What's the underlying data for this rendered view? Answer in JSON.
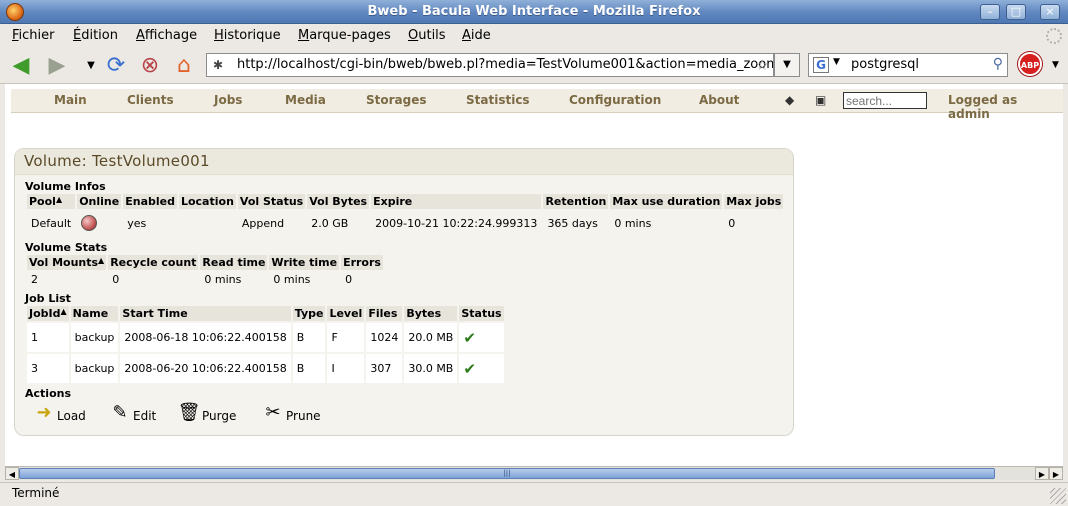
{
  "window": {
    "title": "Bweb - Bacula Web Interface - Mozilla Firefox",
    "min_label": "–",
    "max_label": "□",
    "close_label": "×"
  },
  "menu": [
    "Fichier",
    "Édition",
    "Affichage",
    "Historique",
    "Marque-pages",
    "Outils",
    "Aide"
  ],
  "toolbar": {
    "url": "http://localhost/cgi-bin/bweb/bweb.pl?media=TestVolume001&action=media_zoom",
    "search_value": "postgresql",
    "abp_label": "ABP"
  },
  "site": {
    "nav": [
      "Main",
      "Clients",
      "Jobs",
      "Media",
      "Storages",
      "Statistics",
      "Configuration",
      "About"
    ],
    "search_placeholder": "search...",
    "logged": "Logged as admin"
  },
  "volume": {
    "title": "Volume: TestVolume001",
    "infos_label": "Volume Infos",
    "infos_headers": [
      "Pool",
      "Online",
      "Enabled",
      "Location",
      "Vol Status",
      "Vol Bytes",
      "Expire",
      "Retention",
      "Max use duration",
      "Max jobs"
    ],
    "infos_row": {
      "pool": "Default",
      "enabled": "yes",
      "location": "",
      "vol_status": "Append",
      "vol_bytes": "2.0 GB",
      "expire": "2009-10-21 10:22:24.999313",
      "retention": "365 days",
      "max_use_duration": "0 mins",
      "max_jobs": "0"
    },
    "stats_label": "Volume Stats",
    "stats_headers": [
      "Vol Mounts",
      "Recycle count",
      "Read time",
      "Write time",
      "Errors"
    ],
    "stats_row": [
      "2",
      "0",
      "0 mins",
      "0 mins",
      "0"
    ],
    "joblist_label": "Job List",
    "job_headers": [
      "JobId",
      "Name",
      "Start Time",
      "Type",
      "Level",
      "Files",
      "Bytes",
      "Status"
    ],
    "jobs": [
      {
        "jobid": "1",
        "name": "backup",
        "start": "2008-06-18 10:06:22.400158",
        "type": "B",
        "level": "F",
        "files": "1024",
        "bytes": "20.0 MB"
      },
      {
        "jobid": "3",
        "name": "backup",
        "start": "2008-06-20 10:06:22.400158",
        "type": "B",
        "level": "I",
        "files": "307",
        "bytes": "30.0 MB"
      }
    ],
    "actions_label": "Actions",
    "actions": [
      "Load",
      "Edit",
      "Purge",
      "Prune"
    ]
  },
  "status": "Terminé",
  "scroll_grip": "|||"
}
